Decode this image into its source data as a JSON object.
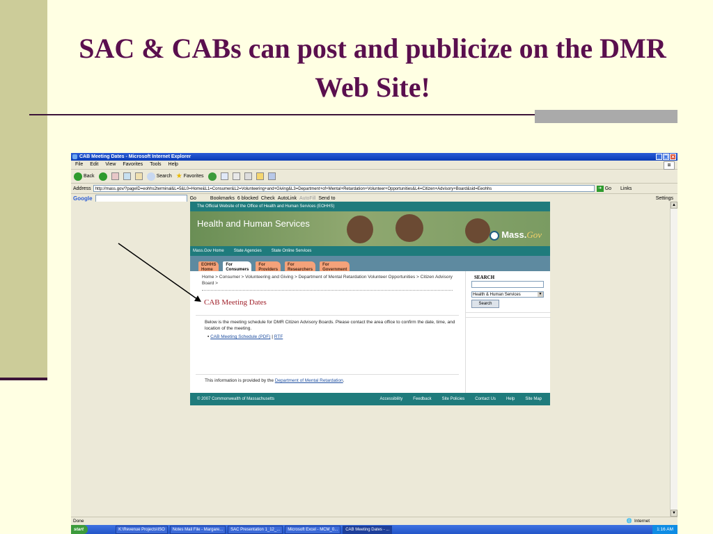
{
  "slide": {
    "title": "SAC & CABs can post and publicize on the DMR Web Site!"
  },
  "browser": {
    "window_title": "CAB Meeting Dates - Microsoft Internet Explorer",
    "menu": [
      "File",
      "Edit",
      "View",
      "Favorites",
      "Tools",
      "Help"
    ],
    "toolbar": {
      "back": "Back",
      "search": "Search",
      "favorites": "Favorites"
    },
    "address_label": "Address",
    "address": "http://mass.gov/?pageID=eohhs2terminal&L=5&L0=Home&L1=Consumer&L2=Volunteering+and+Giving&L3=Department+of+Mental+Retardation+Volunteer+Opportunities&L4=Citizen+Advisory+Board&sid=Eeohhs",
    "go": "Go",
    "links": "Links",
    "google_bar": {
      "logo": "Google",
      "go": "Go",
      "bookmarks": "Bookmarks",
      "blocked": "6 blocked",
      "check": "Check",
      "autolink": "AutoLink",
      "autofill": "AutoFill",
      "send_to": "Send to",
      "settings": "Settings"
    },
    "status": "Done",
    "zone": "Internet"
  },
  "site": {
    "top_bar": "The Official Website of the Office of Health and Human Services (EOHHS)",
    "banner_title": "Health and Human Services",
    "logo": "Mass.",
    "logo_suffix": "Gov",
    "nav_links": [
      "Mass.Gov Home",
      "State Agencies",
      "State Online Services"
    ],
    "tabs": [
      {
        "line1": "EOHHS",
        "line2": "Home"
      },
      {
        "line1": "For",
        "line2": "Consumers"
      },
      {
        "line1": "For",
        "line2": "Providers"
      },
      {
        "line1": "For",
        "line2": "Researchers"
      },
      {
        "line1": "For",
        "line2": "Government"
      }
    ],
    "breadcrumb": "Home > Consumer > Volunteering and Giving > Department of Mental Retardation Volunteer Opportunities > Citizen Advisory Board >",
    "heading": "CAB Meeting Dates",
    "body": "Below is the meeting schedule for DMR Citizen Advisory Boards.  Please contact the area office to confirm the date, time, and location of the meeting.",
    "schedule_link": "CAB Meeting Schedule (PDF)",
    "separator": "|",
    "rtf_link": "RTF",
    "info_prefix": "This information is provided by the",
    "info_link": "Department of Mental Retardation",
    "info_suffix": ".",
    "search_heading": "SEARCH",
    "search_scope": "Health & Human Services",
    "search_button": "Search",
    "copyright": "© 2007 Commonwealth of Massachusetts",
    "footer_links": [
      "Accessibility",
      "Feedback",
      "Site Policies",
      "Contact Us",
      "Help",
      "Site Map"
    ]
  },
  "taskbar": {
    "start": "start",
    "items": [
      "K:\\Revenue Projects\\ISO",
      "Notes Mail File - Margare...",
      "SAC Presentation 1_12_...",
      "Microsoft Excel - MCM_0...",
      "CAB Meeting Dates - ..."
    ],
    "time": "1:16 AM"
  }
}
